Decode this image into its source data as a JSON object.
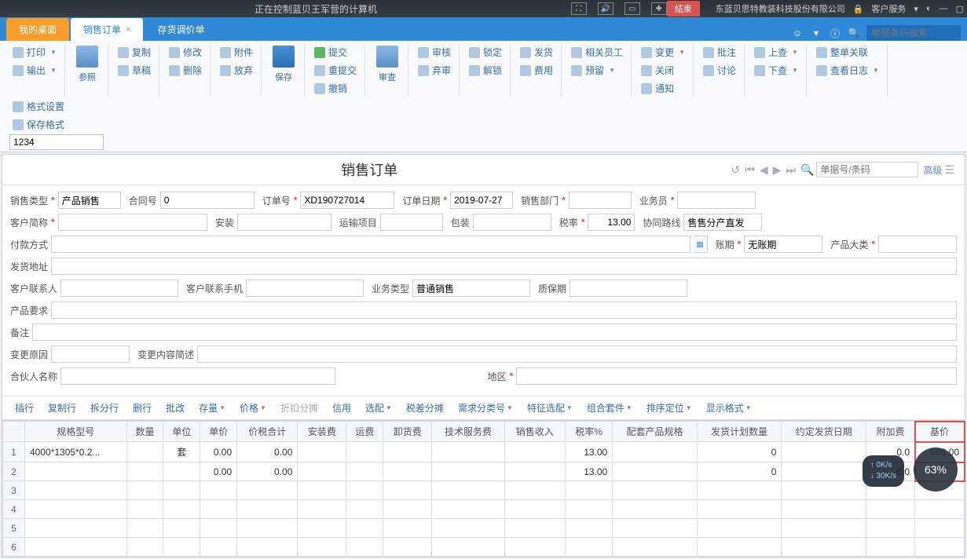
{
  "titlebar": {
    "center_msg": "正在控制蓝贝王军营的计算机",
    "end_btn": "结束",
    "company": "东蓝贝思特教装科技股份有限公司",
    "menu_service": "客户服务"
  },
  "tabs": {
    "desktop": "我的桌面",
    "sales_order": "销售订单",
    "price_adjust": "存货调价单"
  },
  "tabbar_search_ph": "单据条码搜索",
  "ribbon": {
    "print": "打印",
    "export": "输出",
    "ref": "参照",
    "copy": "复制",
    "draft": "草稿",
    "edit": "修改",
    "delete": "删除",
    "attach": "附件",
    "abandon": "放弃",
    "save": "保存",
    "submit": "提交",
    "resubmit": "重提交",
    "revoke": "撤销",
    "review": "审查",
    "audit": "审核",
    "unaudit": "弃审",
    "lock": "锁定",
    "unlock": "解锁",
    "deliver": "发货",
    "cost": "费用",
    "related_emp": "相关员工",
    "reserve": "预留",
    "change": "变更",
    "close": "关闭",
    "notify": "通知",
    "approve": "批注",
    "discuss": "讨论",
    "up_search": "上查",
    "down_search": "下查",
    "full_assoc": "整单关联",
    "view_log": "查看日志",
    "fmt_set": "格式设置",
    "save_fmt": "保存格式",
    "fmt_value": "1234"
  },
  "page_title": "销售订单",
  "search_bill_ph": "单据号/条码",
  "advanced": "高级",
  "form": {
    "labels": {
      "sale_type": "销售类型",
      "contract_no": "合同号",
      "order_no": "订单号",
      "order_date": "订单日期",
      "sale_dept": "销售部门",
      "salesman": "业务员",
      "customer_abbr": "客户简称",
      "install": "安装",
      "transport": "运输项目",
      "package": "包装",
      "tax_rate": "税率",
      "coop_route": "协同路线",
      "pay_method": "付款方式",
      "credit_period": "账期",
      "product_cat": "产品大类",
      "ship_addr": "发货地址",
      "cust_contact": "客户联系人",
      "cust_phone": "客户联系手机",
      "biz_type": "业务类型",
      "warranty": "质保期",
      "product_req": "产品要求",
      "remark": "备注",
      "change_reason": "变更原因",
      "change_summary": "变更内容简述",
      "partner_name": "合伙人名称",
      "region": "地区"
    },
    "values": {
      "sale_type": "产品销售",
      "contract_no": "0",
      "order_no": "XD190727014",
      "order_date": "2019-07-27",
      "tax_rate": "13.00",
      "coop_route": "售售分产直发",
      "credit_period": "无账期",
      "biz_type": "普通销售"
    }
  },
  "grid_toolbar": {
    "insert_row": "插行",
    "copy_row": "复制行",
    "split_row": "拆分行",
    "del_row": "删行",
    "batch": "批改",
    "stock": "存量",
    "price": "价格",
    "discount": "折扣分摊",
    "credit": "信用",
    "match": "选配",
    "tax_diff": "税差分摊",
    "demand_class": "需求分类号",
    "feature": "特征选配",
    "combo": "组合套件",
    "sort": "排序定位",
    "display_fmt": "显示格式"
  },
  "grid": {
    "headers": {
      "spec": "规格型号",
      "qty": "数量",
      "unit": "单位",
      "price": "单价",
      "price_tax": "价税合计",
      "install_fee": "安装费",
      "freight": "运费",
      "unload_fee": "卸货费",
      "tech_fee": "技术服务费",
      "sale_income": "销售收入",
      "tax_pct": "税率%",
      "kit_spec": "配套产品规格",
      "ship_plan_qty": "发货计划数量",
      "agreed_date": "约定发货日期",
      "extra_fee": "附加费",
      "base_price": "基价"
    },
    "rows": [
      {
        "n": "1",
        "spec": "4000*1305*0.2...",
        "unit": "套",
        "price": "0.00",
        "price_tax": "0.00",
        "tax_pct": "13.00",
        "ship_plan_qty": "0",
        "extra_fee": "0.0",
        "base_price": "666.00"
      },
      {
        "n": "2",
        "spec": "",
        "unit": "",
        "price": "0.00",
        "price_tax": "0.00",
        "tax_pct": "13.00",
        "ship_plan_qty": "0",
        "extra_fee": "0.0",
        "base_price": ""
      },
      {
        "n": "3"
      },
      {
        "n": "4"
      },
      {
        "n": "5"
      },
      {
        "n": "6"
      }
    ]
  },
  "overlay": {
    "percent": "63%",
    "net_up": "0K/s",
    "net_down": "30K/s"
  }
}
